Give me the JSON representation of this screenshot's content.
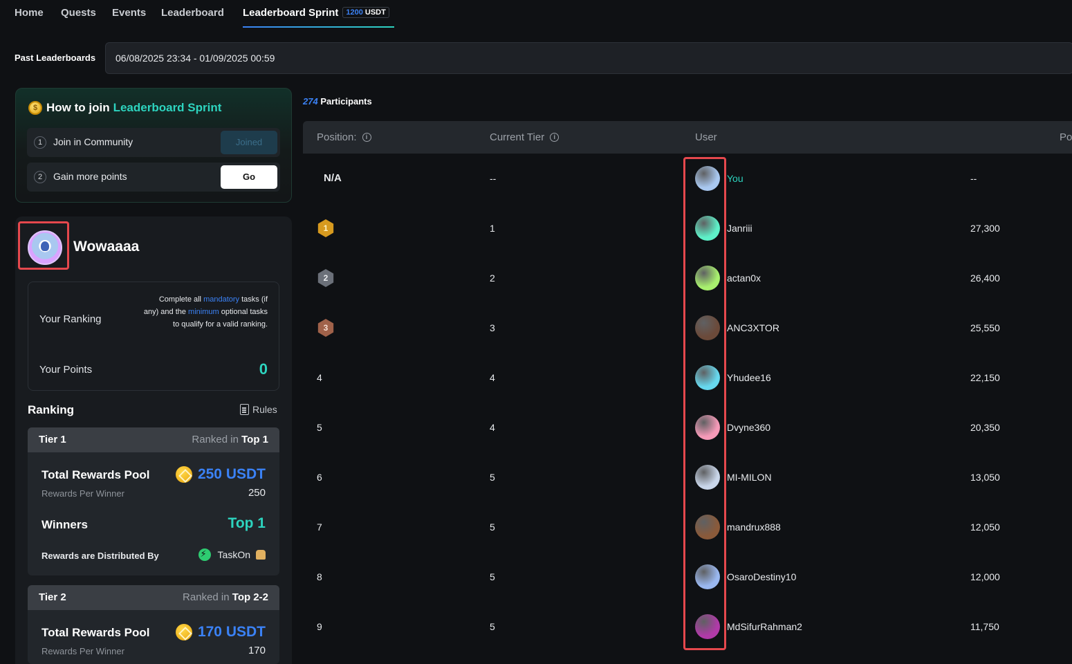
{
  "nav": {
    "tabs": [
      "Home",
      "Quests",
      "Events",
      "Leaderboard"
    ],
    "active_tab": "Leaderboard Sprint",
    "badge_amount": "1200",
    "badge_currency": "USDT"
  },
  "past": {
    "label": "Past Leaderboards",
    "selected_range": "06/08/2025 23:34 - 01/09/2025 00:59"
  },
  "join": {
    "title_prefix": "How to join",
    "title_highlight": "Leaderboard Sprint",
    "steps": [
      {
        "num": "1",
        "label": "Join in Community",
        "button": "Joined"
      },
      {
        "num": "2",
        "label": "Gain more points",
        "button": "Go"
      }
    ]
  },
  "profile": {
    "username": "Wowaaaa",
    "ranking_label": "Your Ranking",
    "note_1": "Complete all ",
    "note_mandatory": "mandatory",
    "note_2": " tasks (if any) and the ",
    "note_minimum": "minimum",
    "note_3": " optional tasks to qualify for a valid ranking.",
    "points_label": "Your Points",
    "points_value": "0"
  },
  "ranking": {
    "title": "Ranking",
    "rules_label": "Rules",
    "tiers": [
      {
        "name": "Tier 1",
        "ranked_in": "Ranked in",
        "ranked_top": "Top 1",
        "pool_label": "Total Rewards Pool",
        "pool_value": "250 USDT",
        "per_winner_label": "Rewards Per Winner",
        "per_winner_value": "250",
        "winners_label": "Winners",
        "winners_value": "Top 1",
        "distributed_label": "Rewards are Distributed By",
        "distributor": "TaskOn"
      },
      {
        "name": "Tier 2",
        "ranked_in": "Ranked in",
        "ranked_top": "Top 2-2",
        "pool_label": "Total Rewards Pool",
        "pool_value": "170 USDT",
        "per_winner_label": "Rewards Per Winner",
        "per_winner_value": "170"
      }
    ]
  },
  "leaderboard": {
    "participants_count": "274",
    "participants_label": "Participants",
    "headers": {
      "position": "Position:",
      "tier": "Current Tier",
      "user": "User",
      "points": "Po"
    },
    "rows": [
      {
        "position": "N/A",
        "medal": "",
        "tier": "--",
        "user": "You",
        "points": "--",
        "avatar_color": "#a9c8f0",
        "is_you": true
      },
      {
        "position": "1",
        "medal": "gold",
        "tier": "1",
        "user": "Janriii",
        "points": "27,300",
        "avatar_color": "#5ef0c8"
      },
      {
        "position": "2",
        "medal": "silver",
        "tier": "2",
        "user": "actan0x",
        "points": "26,400",
        "avatar_color": "#a8f06e"
      },
      {
        "position": "3",
        "medal": "bronze",
        "tier": "3",
        "user": "ANC3XTOR",
        "points": "25,550",
        "avatar_color": "#6b4a3a"
      },
      {
        "position": "4",
        "medal": "",
        "tier": "4",
        "user": "Yhudee16",
        "points": "22,150",
        "avatar_color": "#67d8ee"
      },
      {
        "position": "5",
        "medal": "",
        "tier": "4",
        "user": "Dvyne360",
        "points": "20,350",
        "avatar_color": "#f59ab8"
      },
      {
        "position": "6",
        "medal": "",
        "tier": "5",
        "user": "MI-MILON",
        "points": "13,050",
        "avatar_color": "#c9d6ea"
      },
      {
        "position": "7",
        "medal": "",
        "tier": "5",
        "user": "mandrux888",
        "points": "12,050",
        "avatar_color": "#8a5a3a"
      },
      {
        "position": "8",
        "medal": "",
        "tier": "5",
        "user": "OsaroDestiny10",
        "points": "12,000",
        "avatar_color": "#9ab8f0"
      },
      {
        "position": "9",
        "medal": "",
        "tier": "5",
        "user": "MdSifurRahman2",
        "points": "11,750",
        "avatar_color": "#b03aa8"
      }
    ]
  }
}
